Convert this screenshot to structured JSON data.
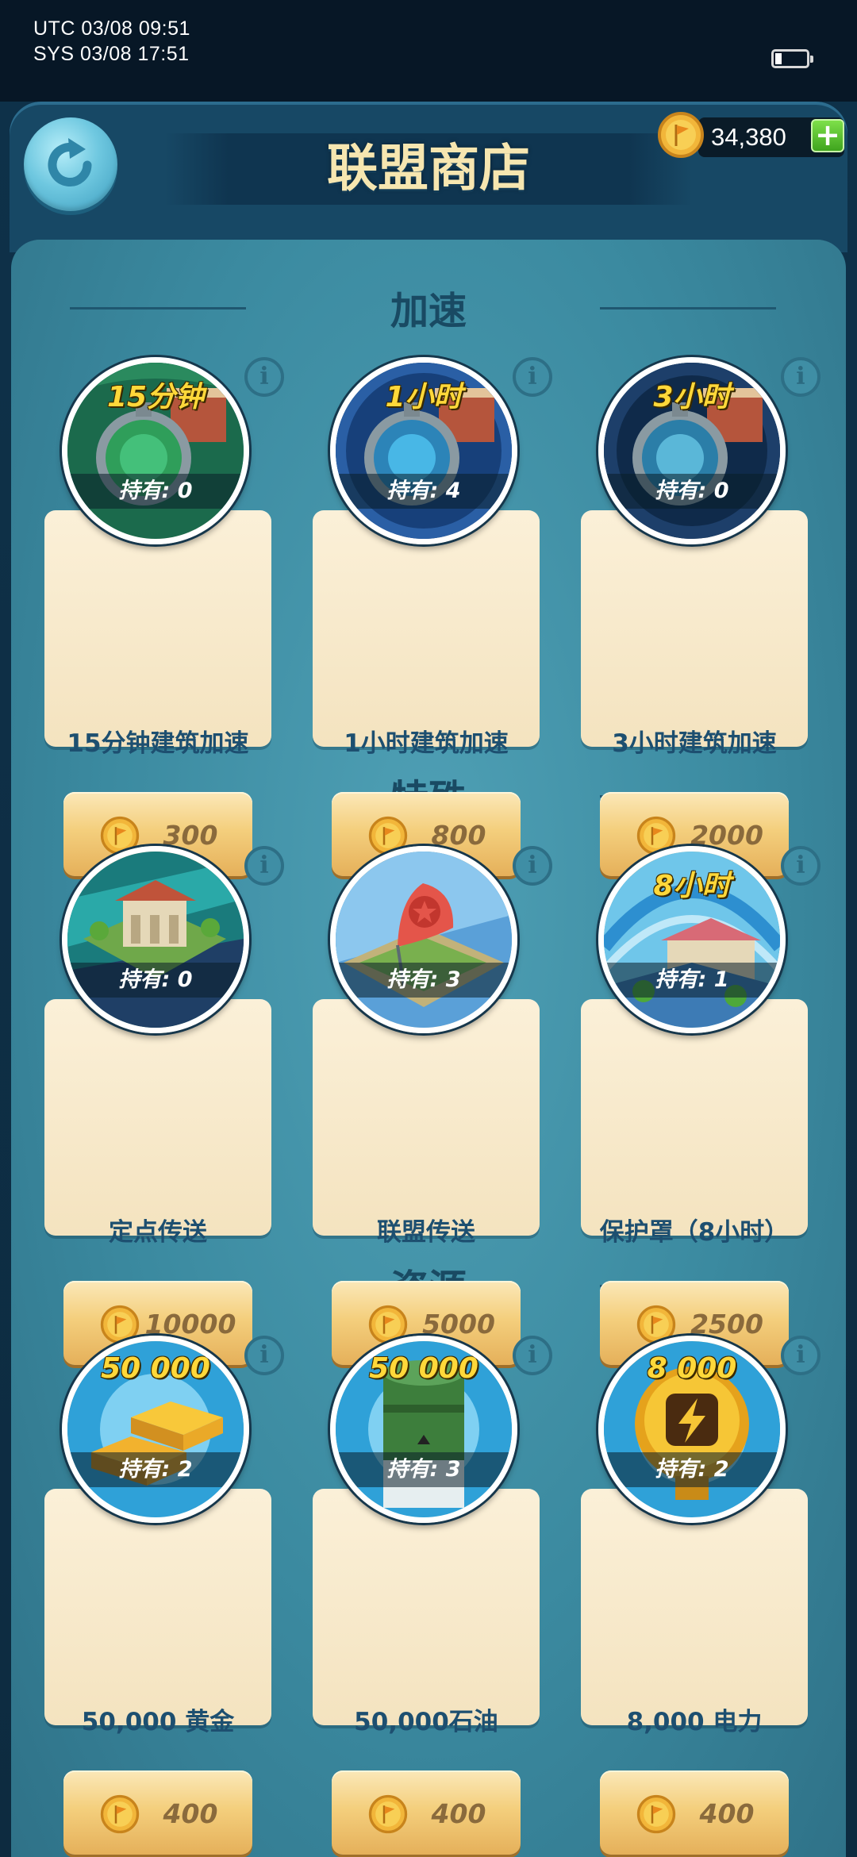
{
  "status_bar": {
    "utc_time": "UTC 03/08 09:51",
    "sys_time": "SYS 03/08 17:51"
  },
  "header": {
    "title": "联盟商店",
    "currency_amount": "34,380",
    "add_label": "+"
  },
  "colors": {
    "panel": "#3b8aa0",
    "card": "#f8ebcc",
    "price_button": "#f4cf7d",
    "title_text": "#f6e6b0",
    "amount_label": "#ffd83a"
  },
  "sections": [
    {
      "heading": "加速",
      "items": [
        {
          "amount_label": "15分钟",
          "owned": "持有: 0",
          "name": "15分钟建筑加速",
          "price": "300",
          "icon": "speedup-stopwatch-green-icon"
        },
        {
          "amount_label": "1小时",
          "owned": "持有: 4",
          "name": "1小时建筑加速",
          "price": "800",
          "icon": "speedup-stopwatch-blue-icon"
        },
        {
          "amount_label": "3小时",
          "owned": "持有: 0",
          "name": "3小时建筑加速",
          "price": "2000",
          "icon": "speedup-stopwatch-dark-icon"
        }
      ]
    },
    {
      "heading": "特殊",
      "items": [
        {
          "amount_label": "",
          "owned": "持有: 0",
          "name": "定点传送",
          "price": "10000",
          "icon": "teleport-building-icon"
        },
        {
          "amount_label": "",
          "owned": "持有: 3",
          "name": "联盟传送",
          "price": "5000",
          "icon": "alliance-teleport-flag-icon"
        },
        {
          "amount_label": "8小时",
          "owned": "持有: 1",
          "name": "保护罩（8小时）",
          "price": "2500",
          "icon": "shield-dome-icon"
        }
      ]
    },
    {
      "heading": "资源",
      "items": [
        {
          "amount_label": "50 000",
          "owned": "持有: 2",
          "name": "50,000 黄金",
          "price": "400",
          "icon": "gold-bars-icon"
        },
        {
          "amount_label": "50 000",
          "owned": "持有: 3",
          "name": "50,000石油",
          "price": "400",
          "icon": "oil-barrel-icon"
        },
        {
          "amount_label": "8 000",
          "owned": "持有: 2",
          "name": "8,000 电力",
          "price": "400",
          "icon": "power-lightning-icon"
        }
      ]
    }
  ]
}
